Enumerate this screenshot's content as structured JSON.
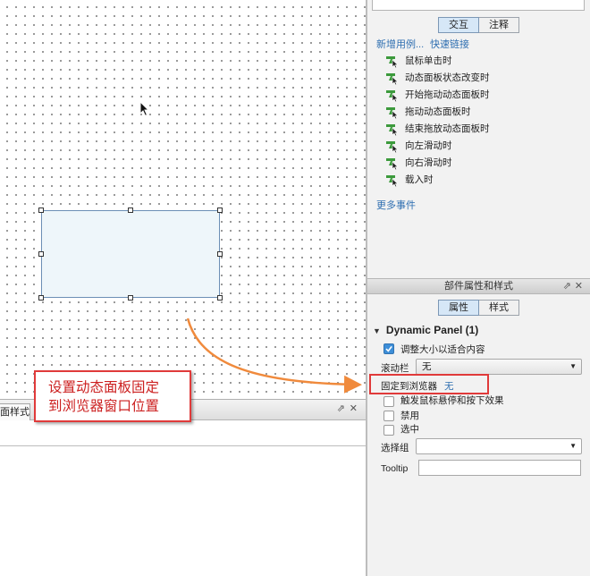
{
  "canvas": {
    "dynamic_panel_selected": true
  },
  "bottom_left_panel": {
    "tab_label": "面样式",
    "pin_icon": "pin-icon",
    "close_icon": "close-icon"
  },
  "interaction_panel": {
    "tabs": [
      "交互",
      "注释"
    ],
    "active_tab": "交互",
    "new_case_link": "新增用例...",
    "quick_link": "快速链接",
    "events": [
      "鼠标单击时",
      "动态面板状态改变时",
      "开始拖动动态面板时",
      "拖动动态面板时",
      "结束拖放动态面板时",
      "向左滑动时",
      "向右滑动时",
      "载入时"
    ],
    "more_events_link": "更多事件",
    "event_icon": "lightning-cursor-icon",
    "event_icon_color": "#3c9a3c"
  },
  "props_panel": {
    "header_title": "部件属性和样式",
    "tabs": [
      "属性",
      "样式"
    ],
    "active_tab": "属性",
    "widget_title": "Dynamic Panel (1)",
    "fit_content_label": "调整大小以适合内容",
    "fit_content_checked": true,
    "scrollbar_label": "滚动栏",
    "scrollbar_value": "无",
    "pin_to_browser_label": "固定到浏览器",
    "pin_to_browser_value": "无",
    "trigger_label": "触发鼠标悬停和按下效果",
    "disabled_label": "禁用",
    "selected_label": "选中",
    "group_label": "选择组",
    "group_value": "",
    "tooltip_label": "Tooltip",
    "tooltip_value": ""
  },
  "annotation": {
    "line1": "设置动态面板固定",
    "line2": "到浏览器窗口位置",
    "border_color": "#e03a3a",
    "arrow_color": "#f08a3c"
  }
}
